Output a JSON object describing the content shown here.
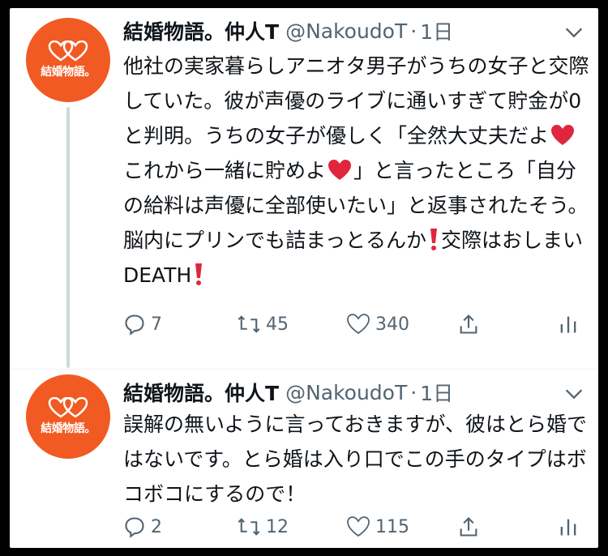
{
  "tweets": [
    {
      "avatar_text": "結婚物語。",
      "name": "結婚物語。仲人T",
      "handle": "@NakoudoT",
      "separator": "·",
      "time": "1日",
      "body_parts": {
        "p1": "他社の実家暮らしアニオタ男子がうちの女子と交際していた。彼が声優のライブに通いすぎて貯金が0と判明。うちの女子が優しく「全然大丈夫だよ",
        "p2": "これから一緒に貯めよ",
        "p3": "」と言ったところ「自分の給料は声優に全部使いたい」と返事されたそう。脳内にプリンでも詰まっとるんか",
        "p4": "交際はおしまい DEATH"
      },
      "emoji": [
        "red-heart",
        "red-heart",
        "red-exclamation",
        "red-exclamation"
      ],
      "stats": {
        "replies": "7",
        "retweets": "45",
        "likes": "340"
      }
    },
    {
      "avatar_text": "結婚物語。",
      "name": "結婚物語。仲人T",
      "handle": "@NakoudoT",
      "separator": "·",
      "time": "1日",
      "body": "誤解の無いように言っておきますが、彼はとら婚ではないです。とら婚は入り口でこの手のタイプはボコボコにするので！",
      "stats": {
        "replies": "2",
        "retweets": "12",
        "likes": "115"
      }
    }
  ],
  "colors": {
    "avatar_bg": "#f15a22",
    "text": "#0f1419",
    "secondary": "#536471",
    "emoji_red": "#e0263d"
  }
}
